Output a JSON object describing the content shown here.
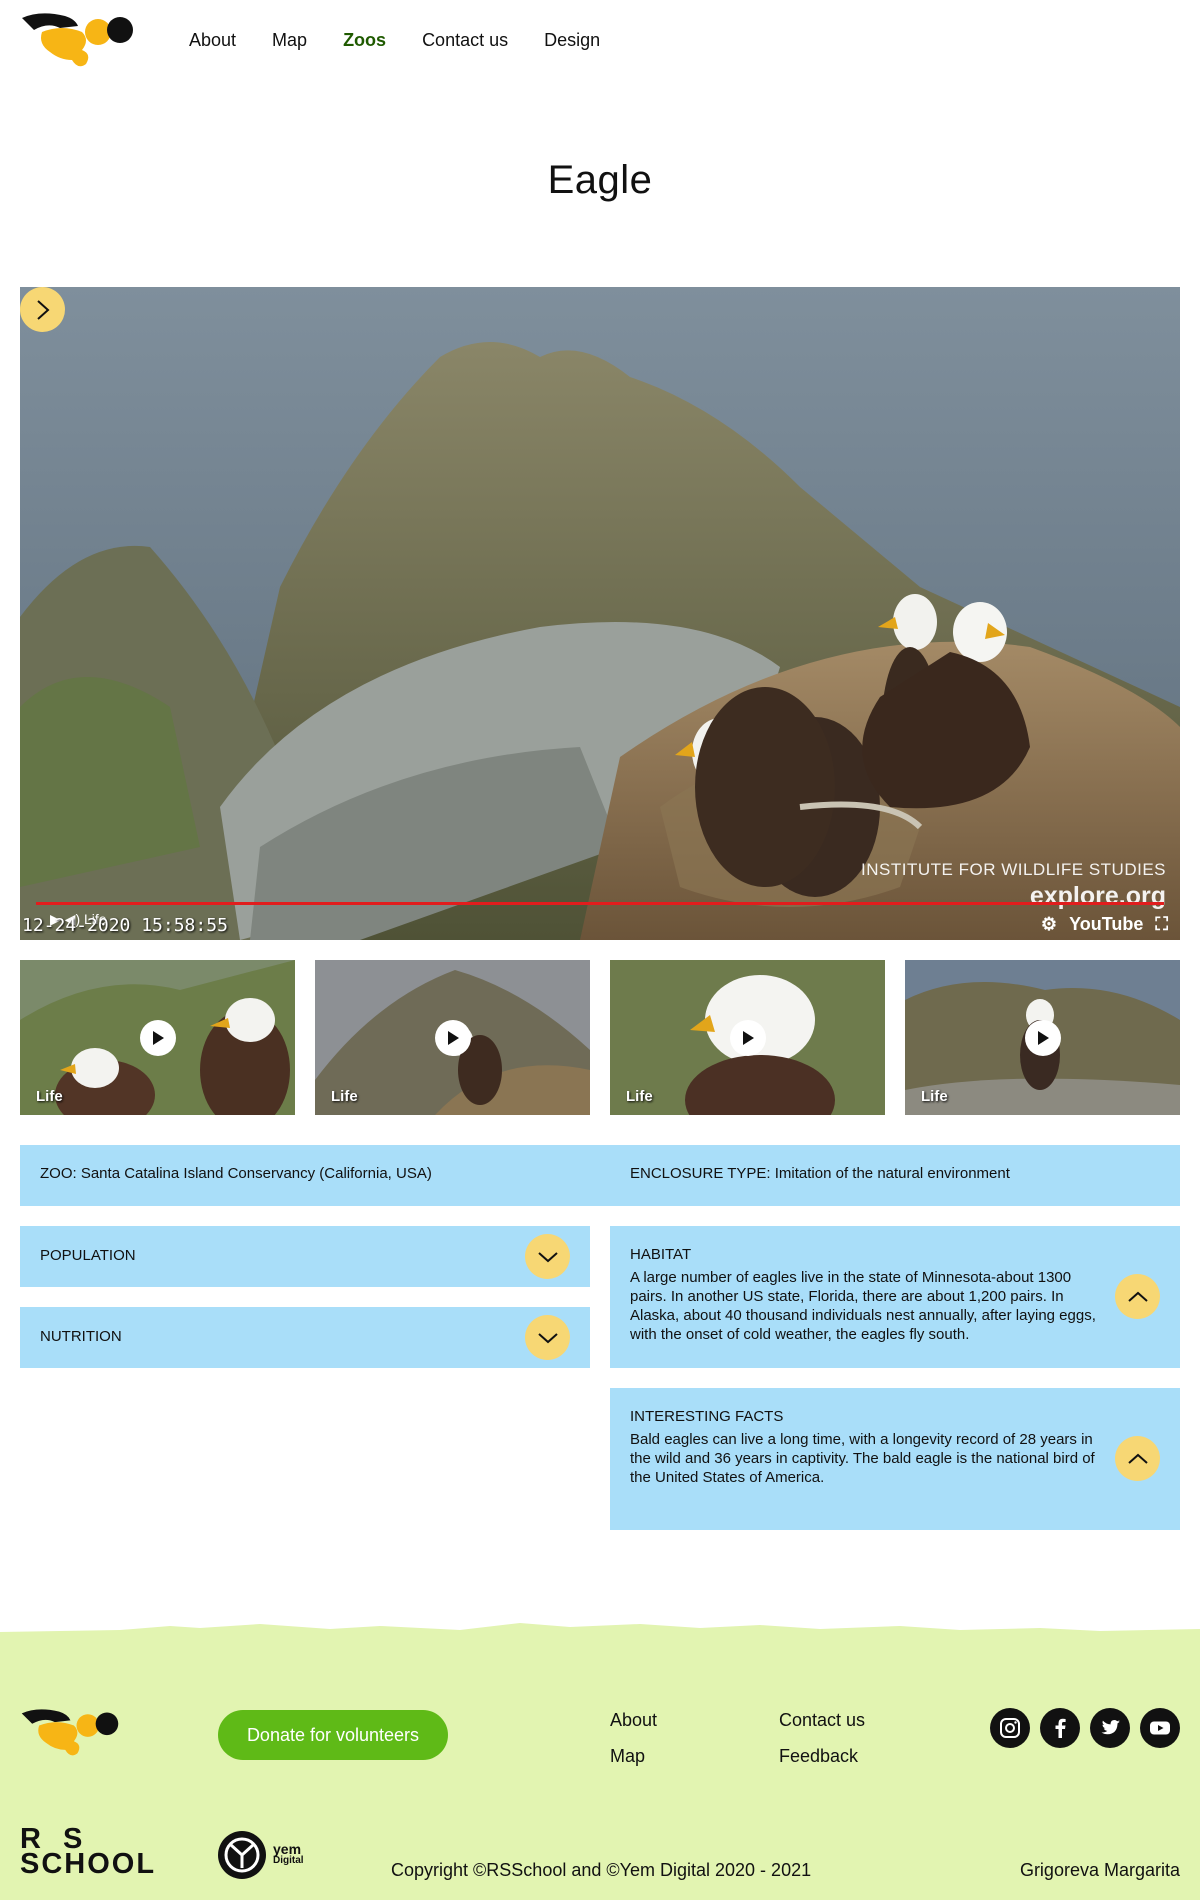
{
  "header": {
    "nav": [
      "About",
      "Map",
      "Zoos",
      "Contact us",
      "Design"
    ],
    "active": "Zoos"
  },
  "page_title": "Eagle",
  "video": {
    "timestamp": "12-24-2020  15:58:55",
    "watermark_line1": "INSTITUTE FOR WILDLIFE STUDIES",
    "watermark_line2": "explore.org",
    "youtube_label": "YouTube",
    "live_label": "Life"
  },
  "thumbnails": [
    {
      "label": "Life"
    },
    {
      "label": "Life"
    },
    {
      "label": "Life"
    },
    {
      "label": "Life"
    }
  ],
  "info": {
    "zoo": "ZOO: Santa Catalina Island Conservancy (California, USA)",
    "enclosure": "ENCLOSURE TYPE: Imitation of the natural environment",
    "population_title": "POPULATION",
    "nutrition_title": "NUTRITION",
    "habitat_title": "HABITAT",
    "habitat_text": "A large number of eagles live in the state of Minnesota-about 1300 pairs. In another US state, Florida, there are about 1,200 pairs. In Alaska, about 40 thousand individuals nest annually, after laying eggs, with the onset of cold weather, the eagles fly south.",
    "facts_title": "INTERESTING FACTS",
    "facts_text": "Bald eagles can live a long time, with a longevity record of 28 years in the wild and 36 years in captivity. The bald eagle is the national bird of the United States of America."
  },
  "footer": {
    "donate": "Donate for volunteers",
    "links": {
      "about": "About",
      "map": "Map",
      "contact": "Contact us",
      "feedback": "Feedback"
    },
    "rs_line1": "R  S",
    "rs_line2": "SCHOOL",
    "yem": "yem",
    "yem_sub": "Digital",
    "copyright": "Copyright ©RSSchool and ©Yem Digital 2020 - 2021",
    "author": "Grigoreva Margarita"
  },
  "colors": {
    "accent_yellow": "#f7d774",
    "panel_blue": "#a9def9",
    "footer_green": "#e2f4b1",
    "donate_green": "#5fba17"
  }
}
